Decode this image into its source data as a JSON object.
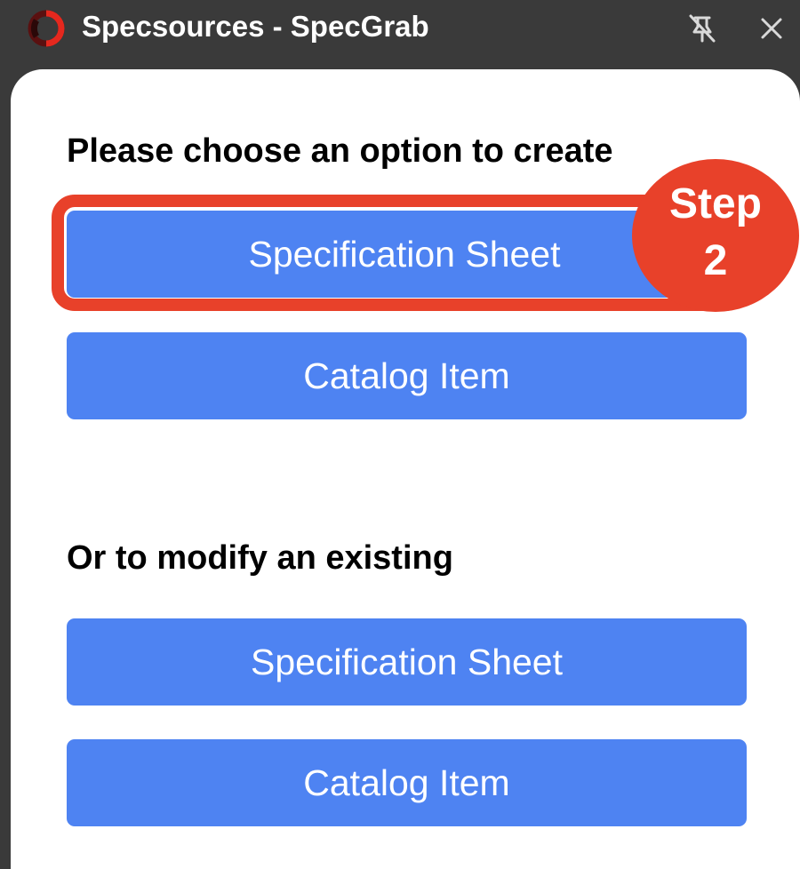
{
  "window": {
    "title": "Specsources - SpecGrab",
    "logo_icon": "specsources-logo-icon",
    "pin_icon": "pin-off-icon",
    "close_icon": "close-icon"
  },
  "create_section": {
    "heading": "Please choose an option to create",
    "buttons": [
      {
        "label": "Specification Sheet"
      },
      {
        "label": "Catalog Item"
      }
    ]
  },
  "modify_section": {
    "heading": "Or to modify an existing",
    "buttons": [
      {
        "label": "Specification Sheet"
      },
      {
        "label": "Catalog Item"
      }
    ]
  },
  "annotation": {
    "step_word": "Step",
    "step_number": "2"
  },
  "colors": {
    "titlebar": "#3a3a3a",
    "button": "#4e83f2",
    "highlight": "#e8412a",
    "panel": "#ffffff"
  }
}
